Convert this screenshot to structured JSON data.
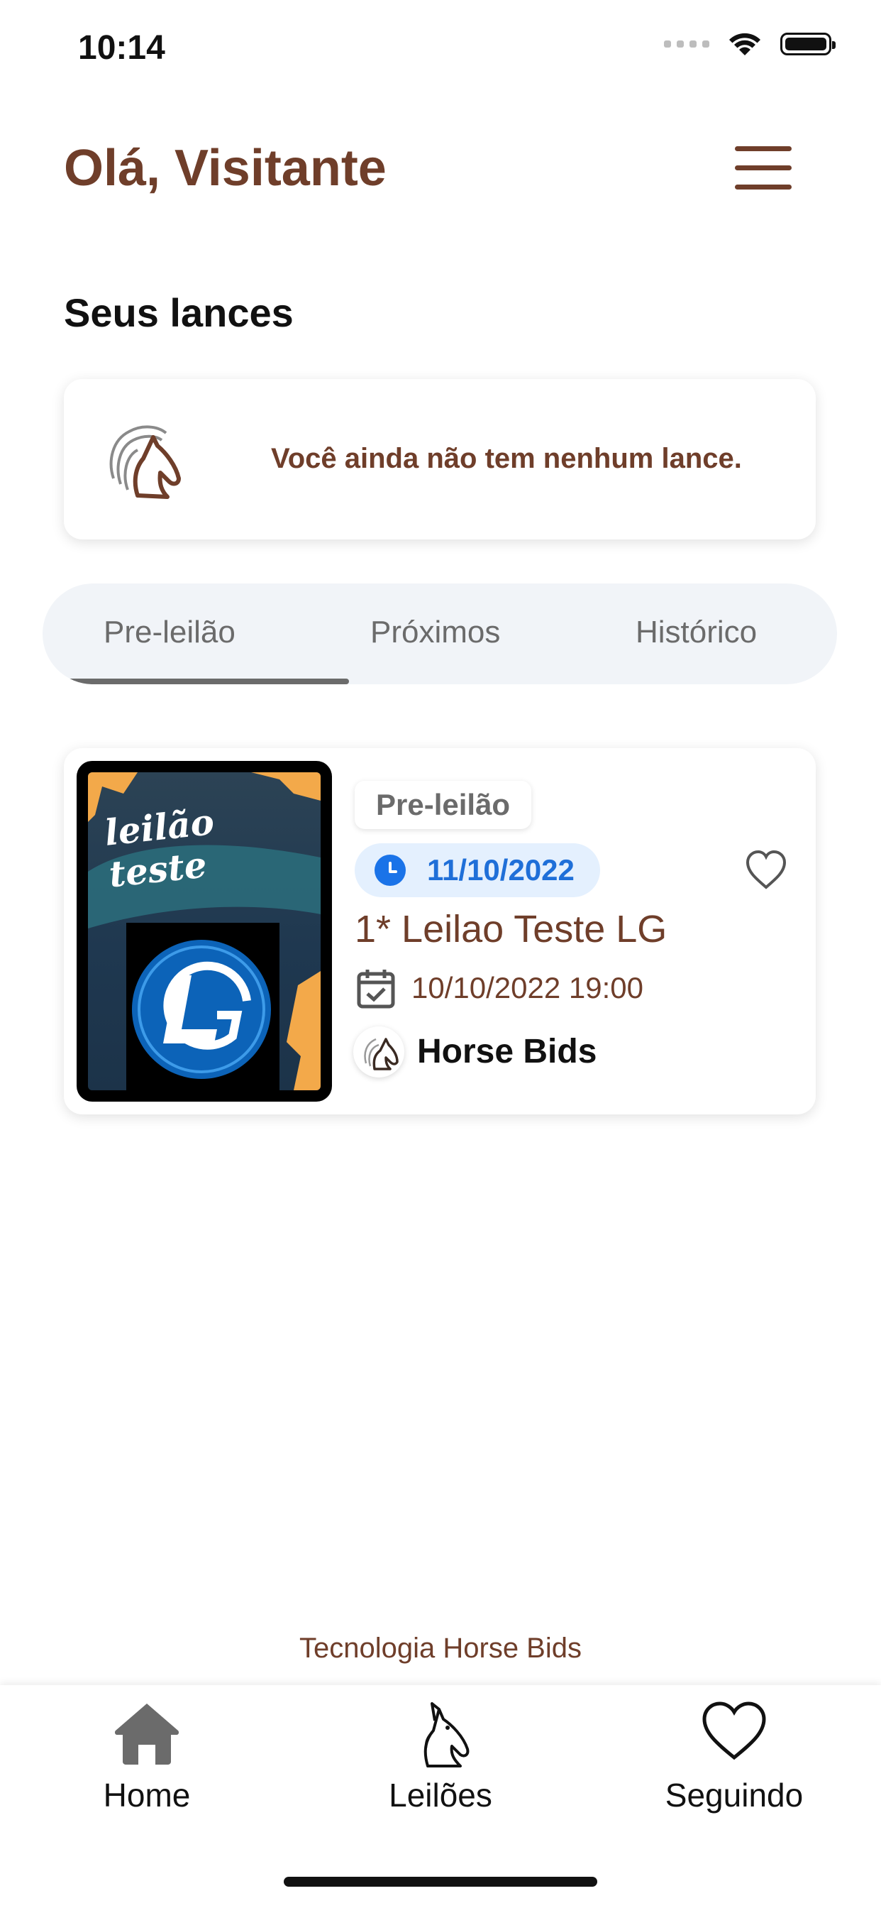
{
  "status_bar": {
    "time": "10:14"
  },
  "header": {
    "greeting": "Olá, Visitante"
  },
  "bids": {
    "title": "Seus lances",
    "empty_message": "Você ainda não tem nenhum lance."
  },
  "tabs": [
    {
      "label": "Pre-leilão",
      "active": true
    },
    {
      "label": "Próximos",
      "active": false
    },
    {
      "label": "Histórico",
      "active": false
    }
  ],
  "auctions": [
    {
      "thumbnail_text": "leilão teste",
      "status": "Pre-leilão",
      "date": "11/10/2022",
      "name": "1* Leilao Teste LG",
      "datetime": "10/10/2022 19:00",
      "organizer": "Horse Bids"
    }
  ],
  "footer": {
    "text": "Tecnologia Horse Bids"
  },
  "bottom_nav": [
    {
      "label": "Home",
      "icon": "home-icon"
    },
    {
      "label": "Leilões",
      "icon": "horse-icon"
    },
    {
      "label": "Seguindo",
      "icon": "heart-icon"
    }
  ],
  "colors": {
    "brand_brown": "#6f3e2a",
    "chip_blue": "#1f6fd8",
    "chip_bg": "#e4f0fe",
    "tab_bg": "#f1f4f8"
  }
}
